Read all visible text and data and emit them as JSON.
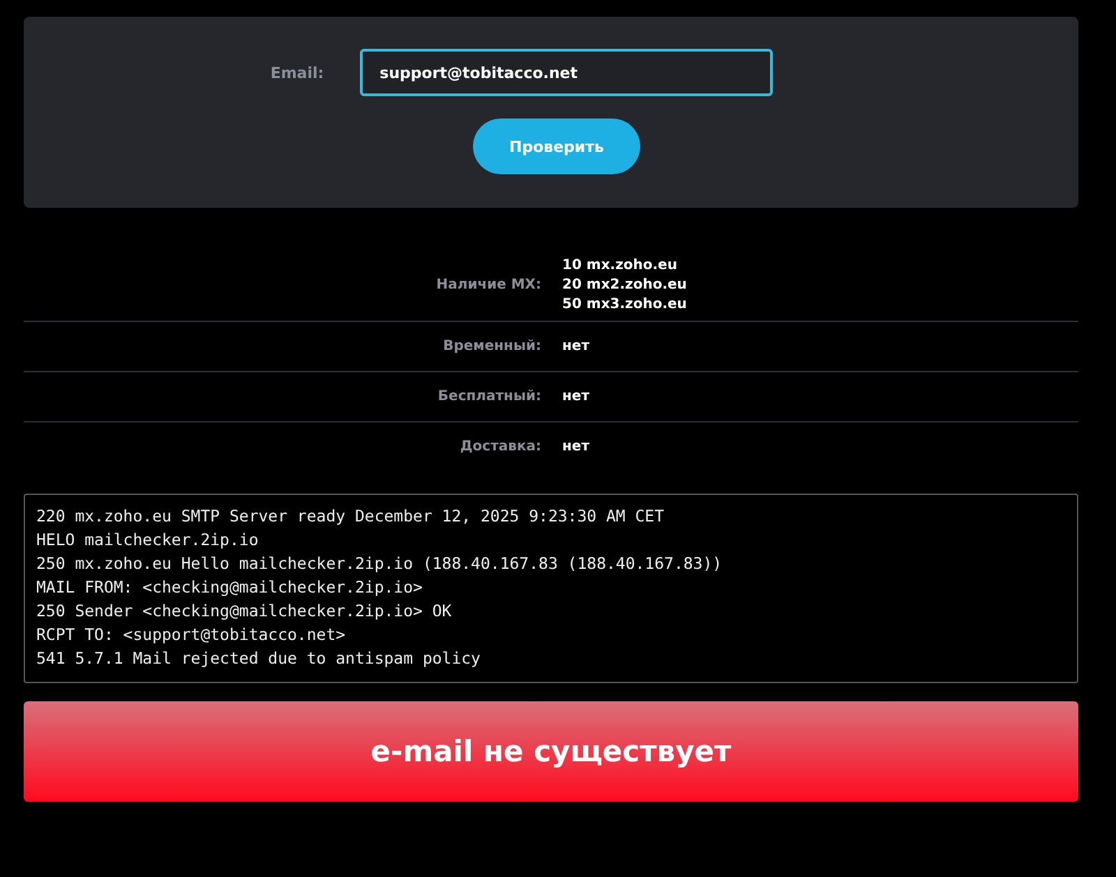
{
  "form": {
    "label": "Email:",
    "value": "support@tobitacco.net",
    "button": "Проверить"
  },
  "details": [
    {
      "kind": "mx",
      "label": "Наличие MX:",
      "records": [
        {
          "priority": "10",
          "host": "mx.zoho.eu"
        },
        {
          "priority": "20",
          "host": "mx2.zoho.eu"
        },
        {
          "priority": "50",
          "host": "mx3.zoho.eu"
        }
      ]
    },
    {
      "kind": "text",
      "label": "Временный:",
      "value": "нет"
    },
    {
      "kind": "text",
      "label": "Бесплатный:",
      "value": "нет"
    },
    {
      "kind": "text",
      "label": "Доставка:",
      "value": "нет"
    }
  ],
  "log": [
    "220 mx.zoho.eu SMTP Server ready December 12, 2025 9:23:30 AM CET",
    "HELO mailchecker.2ip.io",
    "250 mx.zoho.eu Hello mailchecker.2ip.io (188.40.167.83 (188.40.167.83))",
    "MAIL FROM: <checking@mailchecker.2ip.io>",
    "250 Sender <checking@mailchecker.2ip.io> OK",
    "RCPT TO: <support@tobitacco.net>",
    "541 5.7.1 Mail rejected due to antispam policy"
  ],
  "result": {
    "kind": "error",
    "text": "e-mail не существует"
  }
}
